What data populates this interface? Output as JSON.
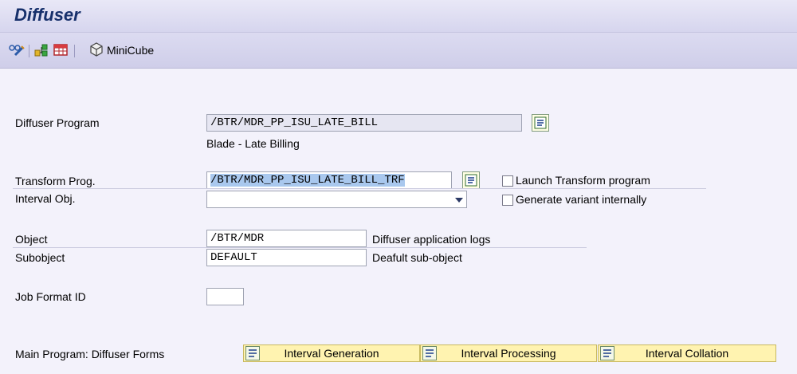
{
  "window": {
    "title": "Diffuser"
  },
  "toolbar": {
    "minicube_label": "MiniCube"
  },
  "form": {
    "diffuser_program": {
      "label": "Diffuser Program",
      "value": "/BTR/MDR_PP_ISU_LATE_BILL",
      "description": "Blade - Late Billing"
    },
    "transform_prog": {
      "label": "Transform Prog.",
      "value": "/BTR/MDR_PP_ISU_LATE_BILL_TRF"
    },
    "launch_transform": {
      "label": "Launch Transform program",
      "checked": false
    },
    "interval_obj": {
      "label": "Interval Obj.",
      "value": ""
    },
    "generate_variant": {
      "label": "Generate variant internally",
      "checked": false
    },
    "object": {
      "label": "Object",
      "value": "/BTR/MDR",
      "description": "Diffuser application logs"
    },
    "subobject": {
      "label": "Subobject",
      "value": "DEFAULT",
      "description": "Deafult sub-object"
    },
    "job_format_id": {
      "label": "Job Format ID",
      "value": ""
    }
  },
  "main_program": {
    "label": "Main Program: Diffuser Forms",
    "buttons": [
      "Interval Generation",
      "Interval Processing",
      "Interval Collation"
    ]
  }
}
